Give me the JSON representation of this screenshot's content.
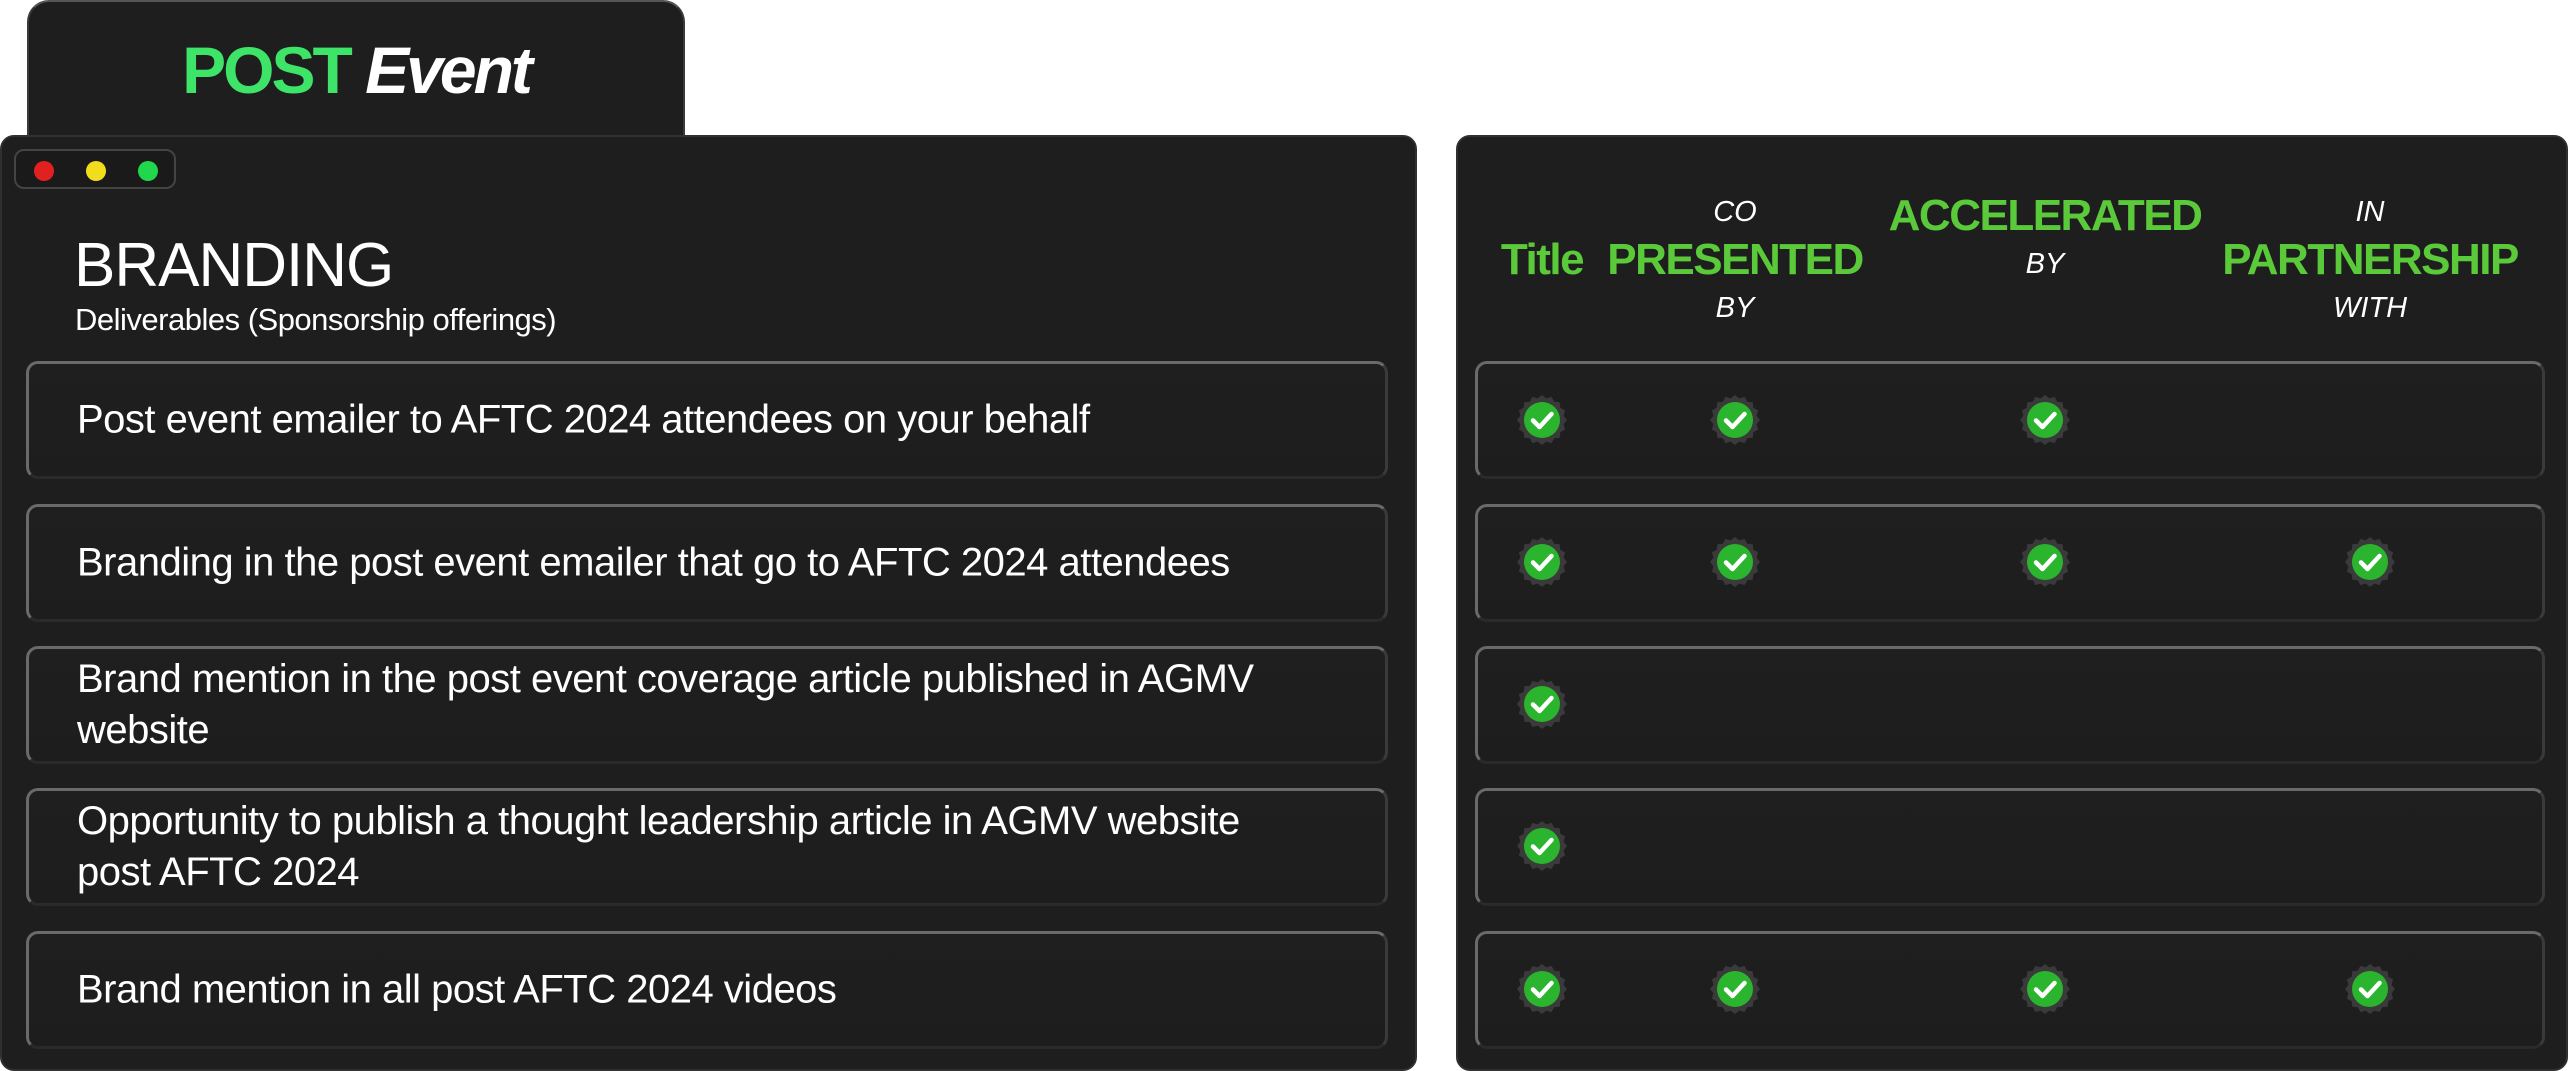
{
  "header_tab": {
    "word1": "POST",
    "word2": "Event"
  },
  "window_controls": [
    "close",
    "minimize",
    "maximize"
  ],
  "left_panel": {
    "title": "BRANDING",
    "subtitle": "Deliverables (Sponsorship offerings)"
  },
  "columns": [
    {
      "top": "",
      "main": "Title",
      "bottom": ""
    },
    {
      "top": "CO",
      "main": "PRESENTED",
      "bottom": "BY"
    },
    {
      "top": "",
      "main": "ACCELERATED",
      "bottom": "BY"
    },
    {
      "top": "IN",
      "main": "PARTNERSHIP",
      "bottom": "WITH"
    }
  ],
  "rows": [
    {
      "text": "Post event emailer to AFTC 2024 attendees on your behalf",
      "checks": [
        true,
        true,
        true,
        false
      ]
    },
    {
      "text": "Branding in the post event emailer that go to AFTC 2024 attendees",
      "checks": [
        true,
        true,
        true,
        true
      ]
    },
    {
      "text": "Brand mention in the post event coverage article published in AGMV website",
      "checks": [
        true,
        false,
        false,
        false
      ]
    },
    {
      "text": "Opportunity to publish a thought leadership article in AGMV website post AFTC 2024",
      "checks": [
        true,
        false,
        false,
        false
      ]
    },
    {
      "text": "Brand mention in all post AFTC 2024 videos",
      "checks": [
        true,
        true,
        true,
        true
      ]
    }
  ],
  "colors": {
    "accent_green": "#3ee468",
    "header_green": "#5ac93a",
    "check_green": "#2bb52f",
    "panel_bg": "#1e1e1e"
  }
}
